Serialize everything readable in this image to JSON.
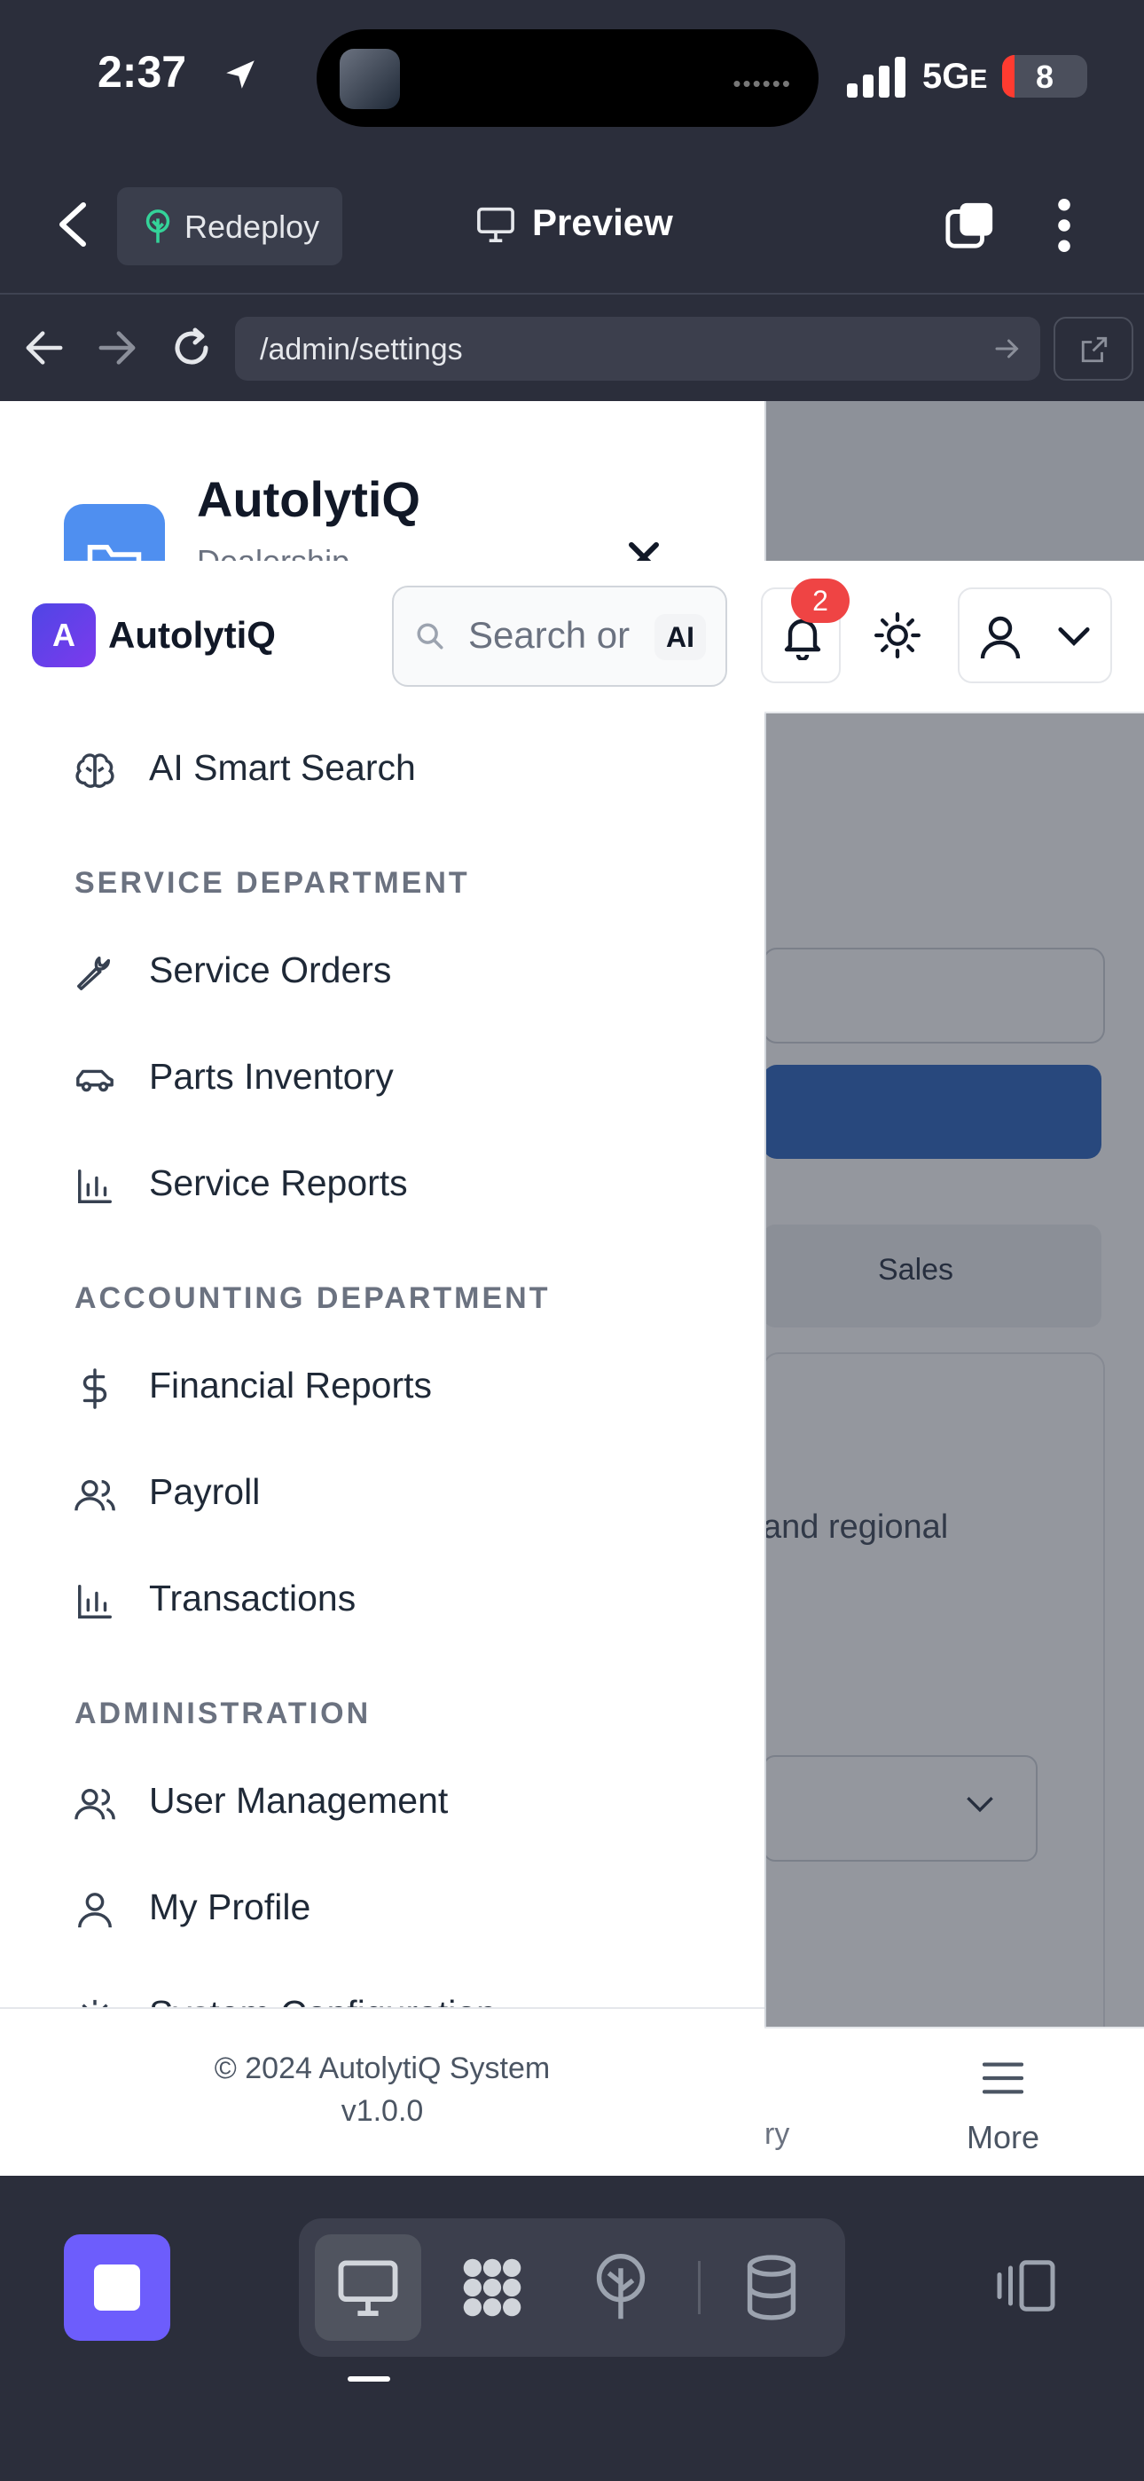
{
  "status_bar": {
    "time": "2:37",
    "network": "5G",
    "network_suffix": "E",
    "battery": "8"
  },
  "app_bar": {
    "redeploy_label": "Redeploy",
    "preview_label": "Preview"
  },
  "browser": {
    "url": "/admin/settings"
  },
  "background_page": {
    "tab_sales": "Sales",
    "description_fragment": "and regional",
    "bottom_nav_partial": "ry",
    "more_label": "More"
  },
  "drawer": {
    "title": "AutolytiQ",
    "subtitle": "Dealership",
    "footer_copyright": "© 2024 AutolytiQ System",
    "footer_version": "v1.0.0"
  },
  "header": {
    "logo_letter": "A",
    "brand": "AutolytiQ",
    "search_placeholder": "Search or",
    "ai_badge": "AI",
    "notification_count": "2"
  },
  "nav": {
    "ai_search": "AI Smart Search",
    "service_section": "SERVICE DEPARTMENT",
    "service_items": [
      "Service Orders",
      "Parts Inventory",
      "Service Reports"
    ],
    "accounting_section": "ACCOUNTING DEPARTMENT",
    "accounting_items": [
      "Financial Reports",
      "Payroll",
      "Transactions"
    ],
    "admin_section": "ADMINISTRATION",
    "admin_items": [
      "User Management",
      "My Profile",
      "System Configuration"
    ]
  },
  "colors": {
    "chrome_bg": "#2b2e3b",
    "accent_purple": "#6d5dfc",
    "primary_blue": "#3b6fc4",
    "badge_red": "#ef4444"
  }
}
